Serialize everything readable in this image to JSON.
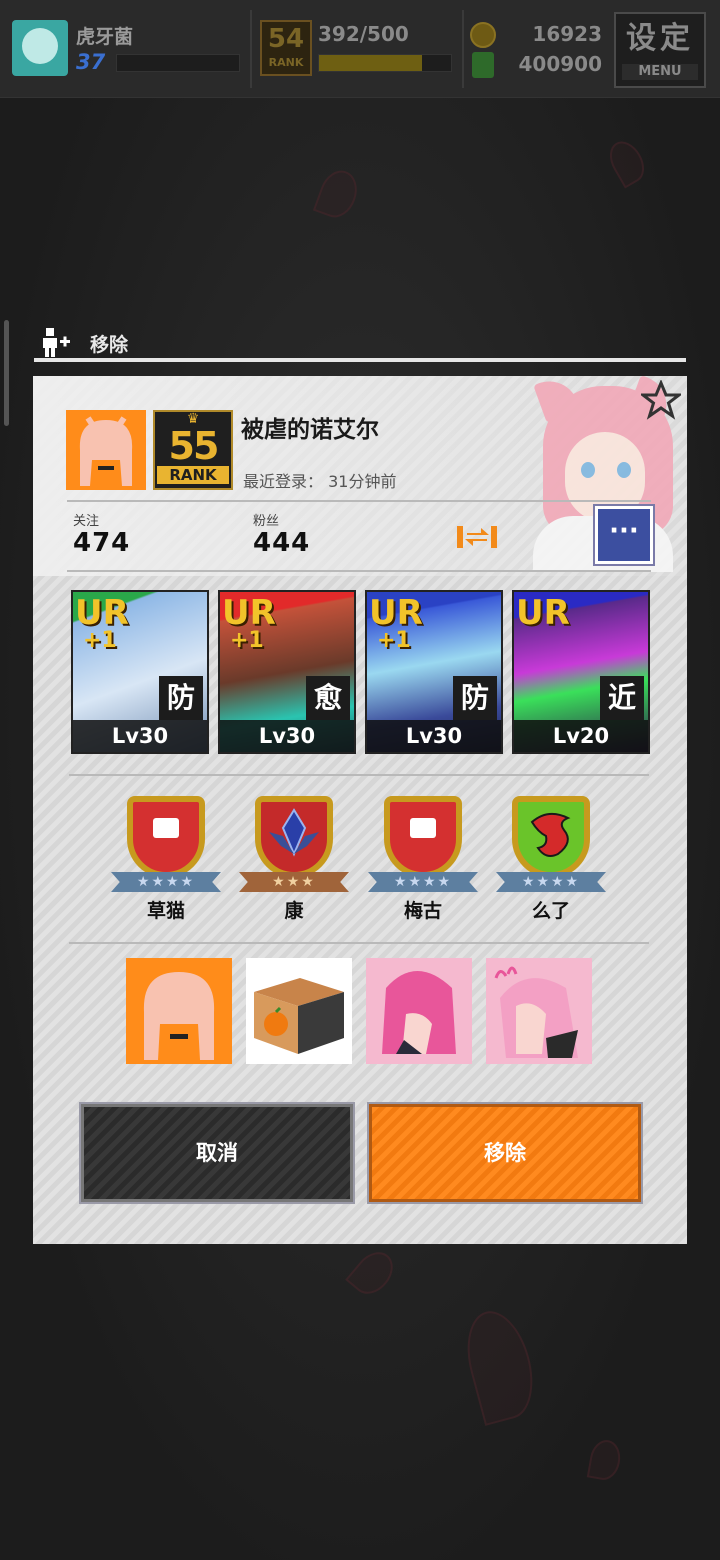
{
  "hud": {
    "player_name": "虎牙菌",
    "level": "37",
    "rank": "54",
    "rank_label": "RANK",
    "exp": "392/500",
    "exp_fraction": 0.78,
    "coins": "16923",
    "cash": "400900",
    "menu_main": "设定",
    "menu_sub": "MENU"
  },
  "dialog": {
    "title": "移除"
  },
  "profile": {
    "name": "被虐的诺艾尔",
    "rank": "55",
    "rank_label": "RANK",
    "last_login": "最近登录：  31分钟前",
    "follow_label": "关注",
    "follow_value": "474",
    "fans_label": "粉丝",
    "fans_value": "444",
    "more_label": "···"
  },
  "cards": [
    {
      "rarity": "UR",
      "plus": "+1",
      "role": "防",
      "level": "Lv30"
    },
    {
      "rarity": "UR",
      "plus": "+1",
      "role": "愈",
      "level": "Lv30"
    },
    {
      "rarity": "UR",
      "plus": "+1",
      "role": "防",
      "level": "Lv30"
    },
    {
      "rarity": "UR",
      "plus": "",
      "role": "近",
      "level": "Lv20"
    }
  ],
  "badges": [
    {
      "name": "草猫",
      "stars": "★★★★"
    },
    {
      "name": "康",
      "stars": "★★★"
    },
    {
      "name": "梅古",
      "stars": "★★★★"
    },
    {
      "name": "么了",
      "stars": "★★★★"
    }
  ],
  "buttons": {
    "cancel": "取消",
    "remove": "移除"
  },
  "colors": {
    "accent_orange": "#ff8c1a",
    "rank_gold": "#e9b430",
    "more_button_blue": "#3c4fa0"
  }
}
